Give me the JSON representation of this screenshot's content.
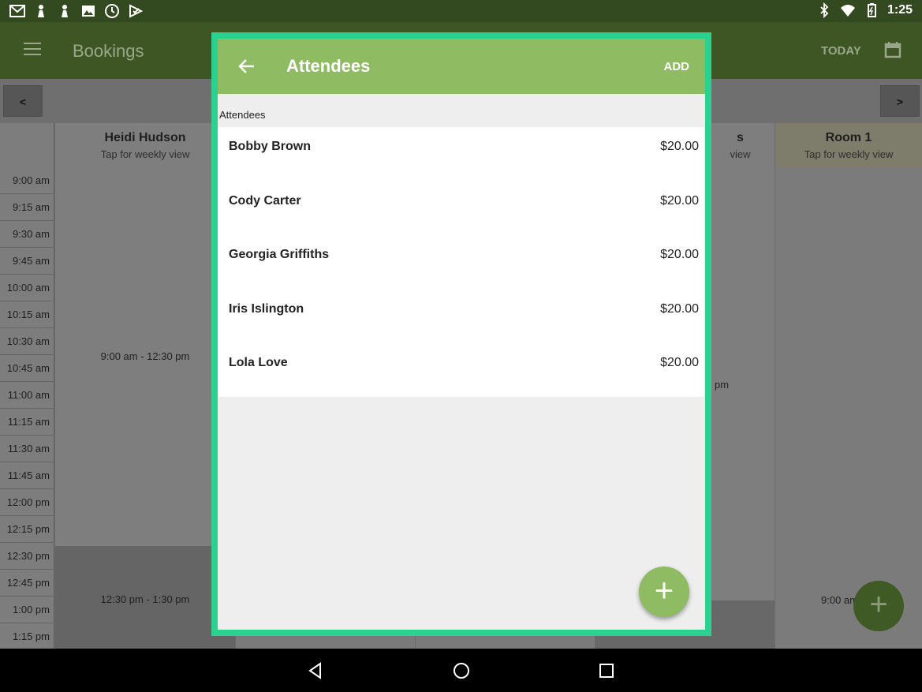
{
  "status_bar": {
    "time": "1:25"
  },
  "app_bar": {
    "title": "Bookings",
    "today_label": "TODAY"
  },
  "nav": {
    "prev_label": "<",
    "next_label": ">"
  },
  "calendar": {
    "times": [
      "9:00 am",
      "9:15 am",
      "9:30 am",
      "9:45 am",
      "10:00 am",
      "10:15 am",
      "10:30 am",
      "10:45 am",
      "11:00 am",
      "11:15 am",
      "11:30 am",
      "11:45 am",
      "12:00 pm",
      "12:15 pm",
      "12:30 pm",
      "12:45 pm",
      "1:00 pm",
      "1:15 pm"
    ],
    "columns": [
      {
        "name": "Heidi Hudson",
        "sub": "Tap for weekly view"
      },
      {
        "name": "s",
        "sub": "view"
      },
      {
        "name": "Room 1",
        "sub": "Tap for weekly view"
      }
    ],
    "events": {
      "heidi_1": "9:00 am - 12:30 pm",
      "heidi_2": "12:30 pm - 1:30 pm",
      "col3_partial": "pm",
      "room_partial": "9:00 am"
    }
  },
  "dialog": {
    "title": "Attendees",
    "add_label": "ADD",
    "section_label": "Attendees",
    "attendees": [
      {
        "name": "Bobby Brown",
        "price": "$20.00"
      },
      {
        "name": "Cody Carter",
        "price": "$20.00"
      },
      {
        "name": "Georgia Griffiths",
        "price": "$20.00"
      },
      {
        "name": "Iris Islington",
        "price": "$20.00"
      },
      {
        "name": "Lola Love",
        "price": "$20.00"
      }
    ],
    "fab_label": "+"
  },
  "colors": {
    "accent": "#8fbc62",
    "dialog_border": "#2ad18f",
    "dark_green": "#33491f"
  }
}
